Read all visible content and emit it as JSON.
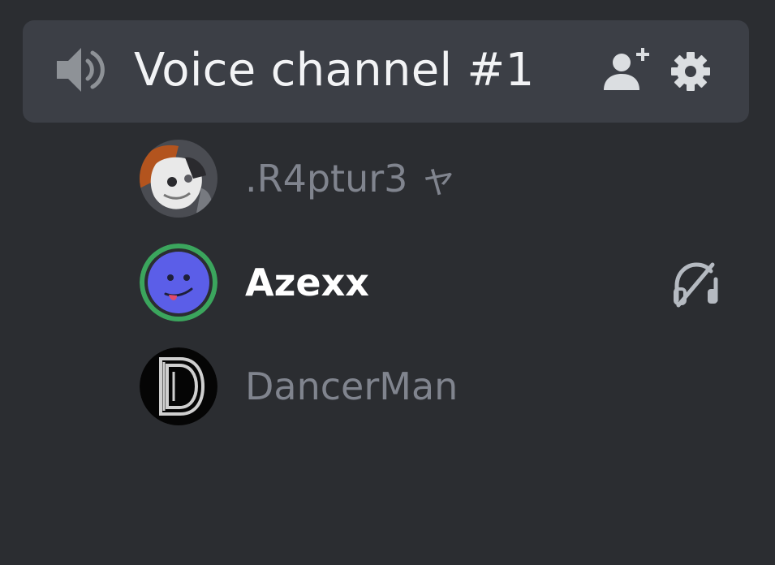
{
  "channel": {
    "name": "Voice channel #1",
    "speaker_icon": "speaker-icon",
    "invite_icon": "add-user-icon",
    "settings_icon": "gear-icon"
  },
  "members": [
    {
      "name": ".R4ptur3 ャ",
      "avatar": "custom-avatar",
      "speaking": false
    },
    {
      "name": "Azexx",
      "avatar": "default-avatar",
      "speaking": true,
      "status_icon": "headphones-deafened-icon"
    },
    {
      "name": "DancerMan",
      "avatar": "letter-d-avatar",
      "speaking": false
    }
  ],
  "colors": {
    "background": "#2b2d31",
    "channel_bg": "#3c3f46",
    "speaking_ring": "#3ba55d",
    "muted_text": "#80848e",
    "active_text": "#ffffff",
    "icon": "#b5bac1"
  }
}
